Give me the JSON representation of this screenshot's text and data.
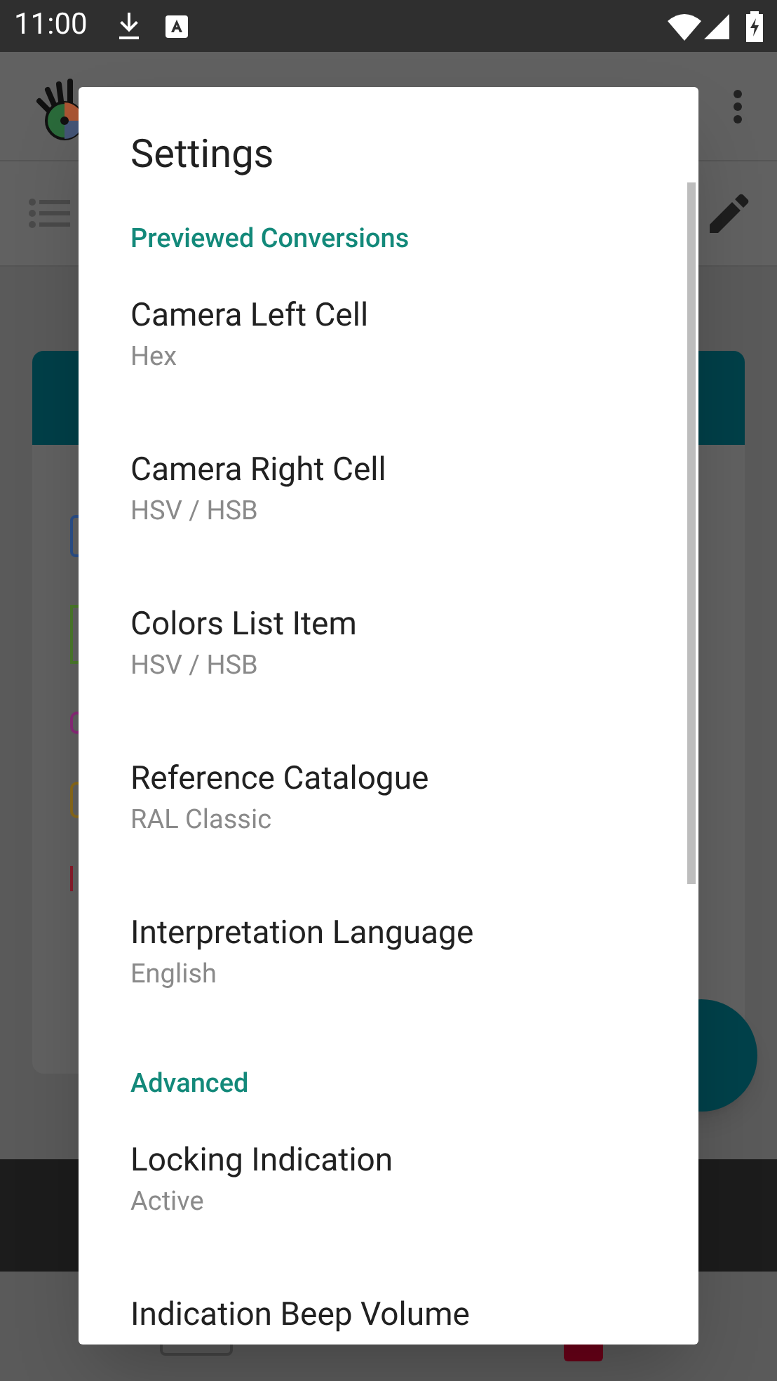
{
  "status_bar": {
    "time": "11:00"
  },
  "dialog": {
    "title": "Settings",
    "sections": [
      {
        "header": "Previewed Conversions",
        "items": [
          {
            "title": "Camera Left Cell",
            "summary": "Hex"
          },
          {
            "title": "Camera Right Cell",
            "summary": "HSV / HSB"
          },
          {
            "title": "Colors List Item",
            "summary": "HSV / HSB"
          },
          {
            "title": "Reference Catalogue",
            "summary": "RAL Classic"
          },
          {
            "title": "Interpretation Language",
            "summary": "English"
          }
        ]
      },
      {
        "header": "Advanced",
        "items": [
          {
            "title": "Locking Indication",
            "summary": "Active"
          },
          {
            "title": "Indication Beep Volume"
          }
        ]
      }
    ]
  }
}
